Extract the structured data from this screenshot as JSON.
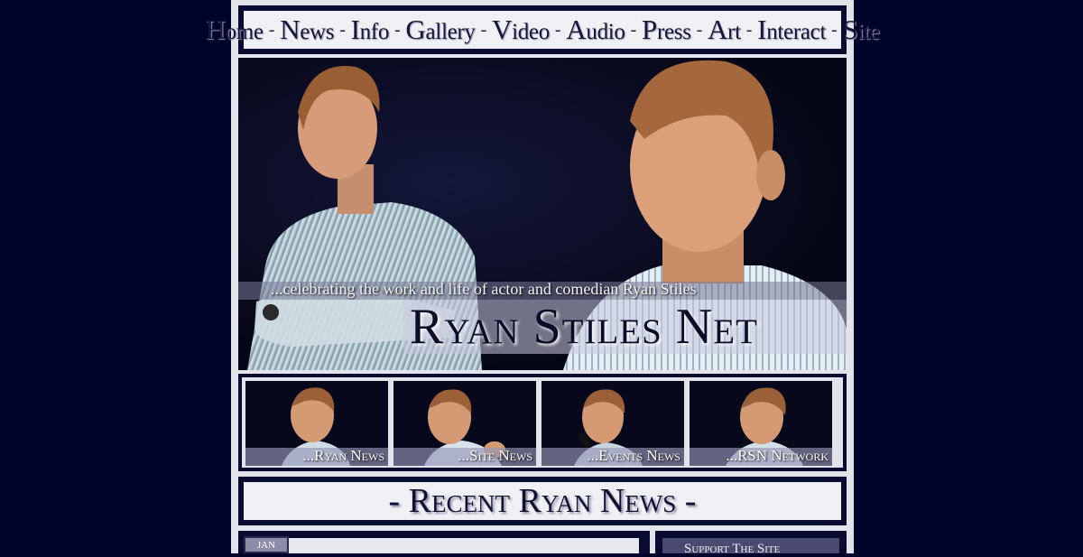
{
  "nav": {
    "items": [
      "Home",
      "News",
      "Info",
      "Gallery",
      "Video",
      "Audio",
      "Press",
      "Art",
      "Interact",
      "Site"
    ],
    "separator": "-"
  },
  "banner": {
    "tagline": "...celebrating the work and life of actor and comedian Ryan Stiles",
    "title": "Ryan Stiles Net"
  },
  "thumbs": [
    {
      "label": "...Ryan News"
    },
    {
      "label": "...Site News"
    },
    {
      "label": "...Events News"
    },
    {
      "label": "...RSN Network"
    }
  ],
  "recent": {
    "heading": "- Recent Ryan News -"
  },
  "news_entry": {
    "date_badge": "JAN"
  },
  "sidebar": {
    "label": "Support The Site"
  },
  "colors": {
    "background": "#02032a",
    "frame": "#0a0b30",
    "panel": "#e3e3ec"
  }
}
